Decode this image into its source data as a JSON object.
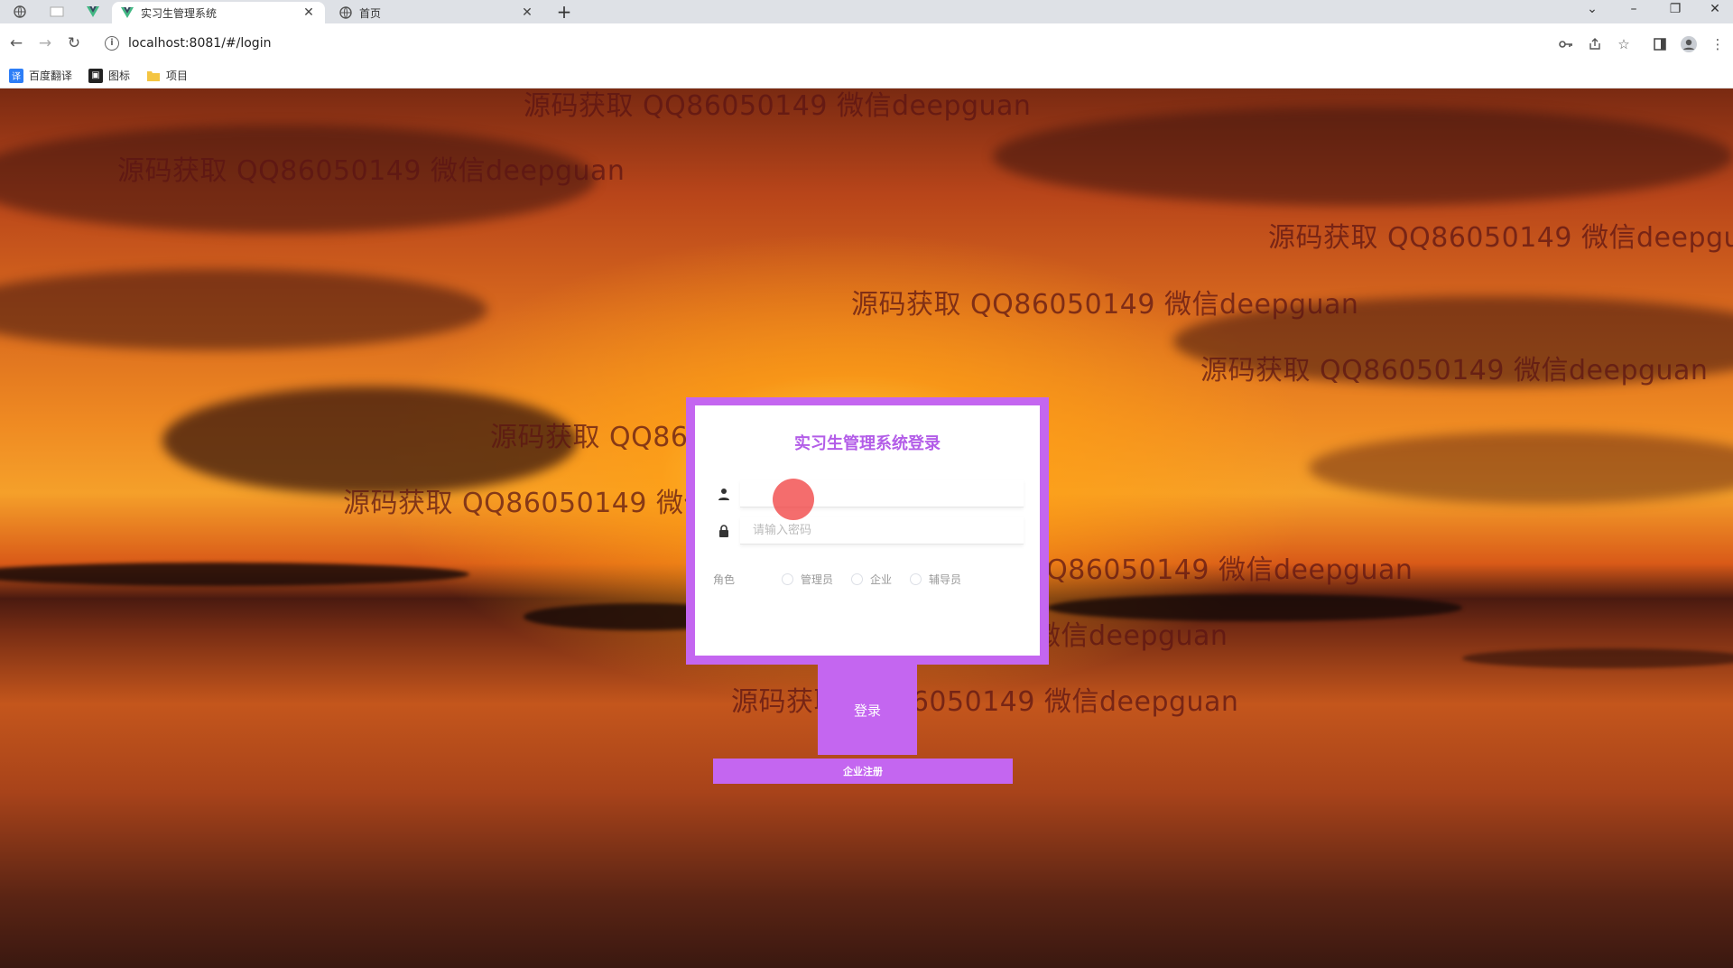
{
  "browser": {
    "tabs": [
      {
        "title": "实习生管理系统",
        "active": true,
        "icon": "vue-logo-icon"
      },
      {
        "title": "首页",
        "active": false,
        "icon": "globe-icon"
      }
    ],
    "url": "localhost:8081/#/login",
    "bookmarks": [
      {
        "label": "百度翻译",
        "icon": "translate-icon"
      },
      {
        "label": "图标",
        "icon": "image-icon"
      },
      {
        "label": "项目",
        "icon": "folder-icon"
      }
    ]
  },
  "login": {
    "title": "实习生管理系统登录",
    "username_value": "",
    "username_placeholder": "",
    "password_placeholder": "请输入密码",
    "role_label": "角色",
    "roles": [
      "管理员",
      "企业",
      "辅导员"
    ],
    "login_button": "登录",
    "register_button": "企业注册"
  },
  "watermark_text": "源码获取 QQ86050149 微信deepguan",
  "colors": {
    "accent": "#c466f0",
    "title": "#b35de8"
  }
}
